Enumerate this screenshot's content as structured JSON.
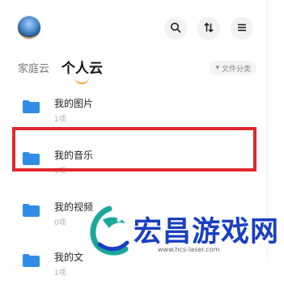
{
  "header": {
    "avatar_icon": "user-avatar",
    "buttons": [
      {
        "icon": "search-icon"
      },
      {
        "icon": "sort-icon"
      },
      {
        "icon": "menu-icon"
      }
    ]
  },
  "tabs": {
    "inactive_label": "家庭云",
    "active_label": "个人云"
  },
  "sort_chip": {
    "label": "文件分类"
  },
  "folders": [
    {
      "name": "我的图片",
      "count": "1项"
    },
    {
      "name": "我的音乐",
      "count": "1项"
    },
    {
      "name": "我的视频",
      "count": "0项"
    },
    {
      "name": "我的文",
      "count": "1项"
    }
  ],
  "highlight_color": "#e0282e",
  "accent_color": "#2f8de8",
  "watermark": {
    "title": "宏昌游戏网",
    "url": "www.hcs-laser.com",
    "title_color": "#1a3fc0"
  }
}
